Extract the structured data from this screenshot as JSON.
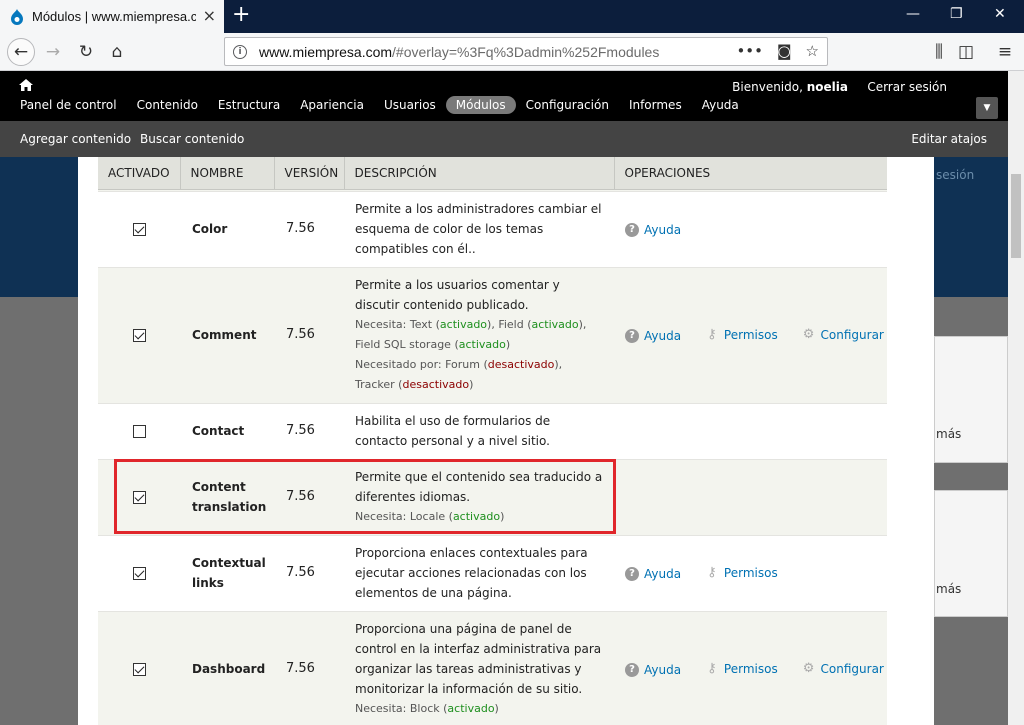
{
  "browser": {
    "tab_title": "Módulos | www.miempresa.com",
    "url_domain": "www.miempresa.com",
    "url_path": "/#overlay=%3Fq%3Dadmin%252Fmodules"
  },
  "toolbar": {
    "menu": [
      "Panel de control",
      "Contenido",
      "Estructura",
      "Apariencia",
      "Usuarios",
      "Módulos",
      "Configuración",
      "Informes",
      "Ayuda"
    ],
    "active_index": 5,
    "welcome": "Bienvenido,",
    "username": "noelia",
    "logout": "Cerrar sesión"
  },
  "shortcuts": {
    "add_content": "Agregar contenido",
    "find_content": "Buscar contenido",
    "edit_shortcuts": "Editar atajos"
  },
  "background": {
    "session_text": "sesión",
    "more_1": "más",
    "more_2": "más"
  },
  "table": {
    "headers": [
      "ACTIVADO",
      "NOMBRE",
      "VERSIÓN",
      "DESCRIPCIÓN",
      "OPERACIONES"
    ],
    "rows": [
      {
        "checked": true,
        "name": "Color",
        "version": "7.56",
        "description": "Permite a los administradores cambiar el esquema de color de los temas compatibles con él..",
        "ops": [
          "Ayuda"
        ]
      },
      {
        "checked": true,
        "name": "Comment",
        "version": "7.56",
        "description": "Permite a los usuarios comentar y discutir contenido publicado.",
        "requires_label": "Necesita:",
        "requires": [
          [
            "Text",
            "activado"
          ],
          [
            "Field",
            "activado"
          ],
          [
            "Field SQL storage",
            "activado"
          ]
        ],
        "required_by_label": "Necesitado por:",
        "required_by": [
          [
            "Forum",
            "desactivado"
          ],
          [
            "Tracker",
            "desactivado"
          ]
        ],
        "ops": [
          "Ayuda",
          "Permisos",
          "Configurar"
        ]
      },
      {
        "checked": false,
        "name": "Contact",
        "version": "7.56",
        "description": "Habilita el uso de formularios de contacto personal y a nivel sitio.",
        "ops": []
      },
      {
        "checked": true,
        "name": "Content translation",
        "version": "7.56",
        "description": "Permite que el contenido sea traducido a diferentes idiomas.",
        "requires_label": "Necesita:",
        "requires": [
          [
            "Locale",
            "activado"
          ]
        ],
        "ops": []
      },
      {
        "checked": true,
        "name": "Contextual links",
        "version": "7.56",
        "description": "Proporciona enlaces contextuales para ejecutar acciones relacionadas con los elementos de una página.",
        "ops": [
          "Ayuda",
          "Permisos"
        ]
      },
      {
        "checked": true,
        "name": "Dashboard",
        "version": "7.56",
        "description": "Proporciona una página de panel de control en la interfaz administrativa para organizar las tareas administrativas y monitorizar la información de su sitio.",
        "requires_label": "Necesita:",
        "requires": [
          [
            "Block",
            "activado"
          ]
        ],
        "ops": [
          "Ayuda",
          "Permisos",
          "Configurar"
        ]
      }
    ]
  }
}
